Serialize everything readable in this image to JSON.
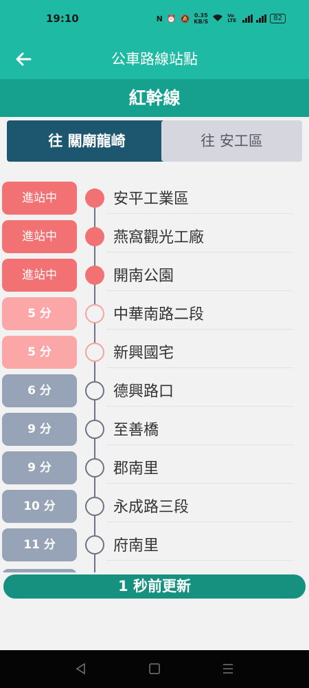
{
  "status_bar": {
    "time": "19:10",
    "net_speed_value": "0.35",
    "net_speed_unit": "KB/S",
    "volte": "Vo LTE",
    "battery": "82"
  },
  "app_bar": {
    "title": "公車路線站點"
  },
  "route": {
    "name": "紅幹線"
  },
  "directions": [
    {
      "label": "往 關廟龍崎",
      "active": true
    },
    {
      "label": "往 安工區",
      "active": false
    }
  ],
  "stops": [
    {
      "status": "進站中",
      "name": "安平工業區",
      "state": "arriving"
    },
    {
      "status": "進站中",
      "name": "燕窩觀光工廠",
      "state": "arriving"
    },
    {
      "status": "進站中",
      "name": "開南公園",
      "state": "arriving"
    },
    {
      "status": "5 分",
      "name": "中華南路二段",
      "state": "soon"
    },
    {
      "status": "5 分",
      "name": "新興國宅",
      "state": "soon"
    },
    {
      "status": "6 分",
      "name": "德興路口",
      "state": "later"
    },
    {
      "status": "9 分",
      "name": "至善橋",
      "state": "later"
    },
    {
      "status": "9 分",
      "name": "郡南里",
      "state": "later"
    },
    {
      "status": "10 分",
      "name": "永成路三段",
      "state": "later"
    },
    {
      "status": "11 分",
      "name": "府南里",
      "state": "later"
    }
  ],
  "update": {
    "label": "1 秒前更新"
  },
  "colors": {
    "teal": "#1ebaa4",
    "teal_dark": "#16a08e",
    "navy": "#1d566f",
    "arriving": "#f27173",
    "soon": "#fba7a7",
    "later": "#97a3b6"
  },
  "icons": {
    "back": "back-arrow-icon",
    "nav_back": "nav-back-icon",
    "nav_home": "nav-home-icon",
    "nav_recents": "nav-recents-icon"
  }
}
